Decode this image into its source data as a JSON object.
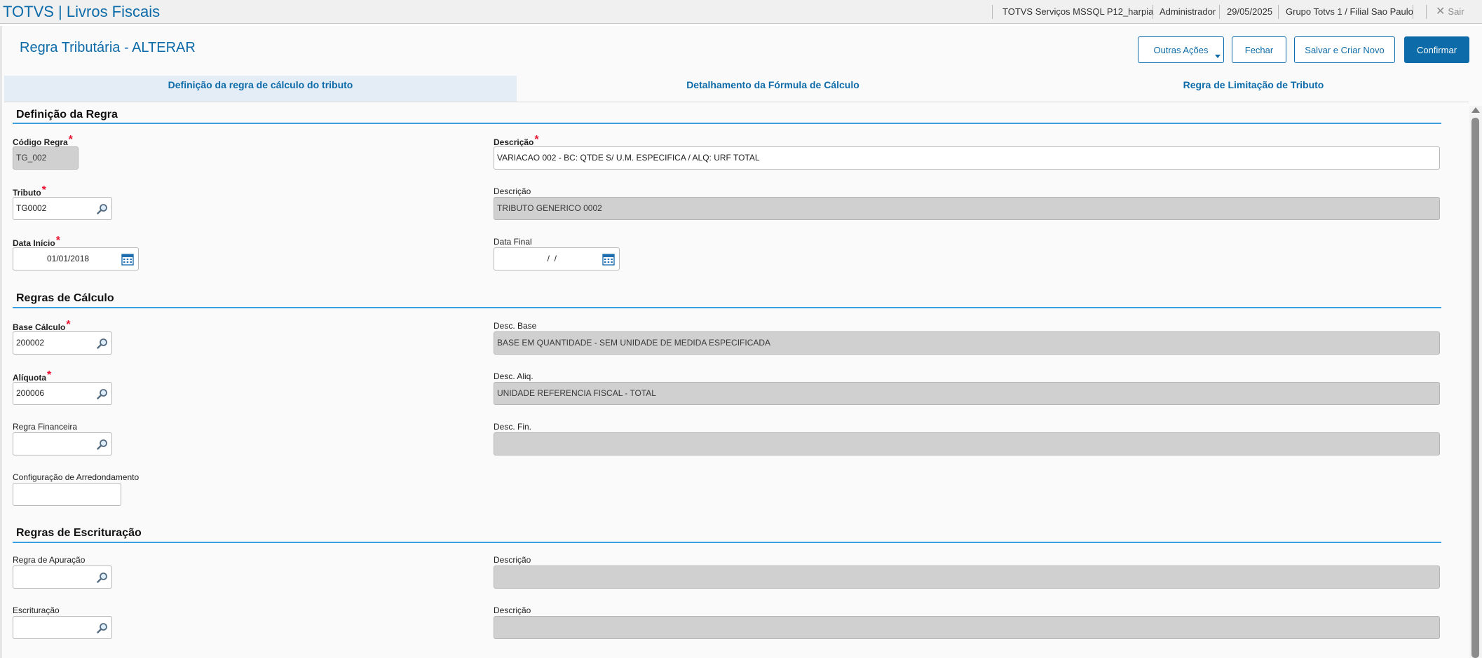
{
  "app": {
    "title": "TOTVS | Livros Fiscais",
    "environment": "TOTVS Serviços MSSQL P12_harpia",
    "user": "Administrador",
    "date": "29/05/2025",
    "branch": "Grupo Totvs 1 / Filial Sao Paulo",
    "logout_label": "Sair"
  },
  "page": {
    "title": "Regra Tributária - ALTERAR",
    "buttons": {
      "other_actions": "Outras Ações",
      "close": "Fechar",
      "save_new": "Salvar e Criar Novo",
      "confirm": "Confirmar"
    },
    "tabs": [
      {
        "label": "Definição da regra de cálculo do tributo",
        "active": true
      },
      {
        "label": "Detalhamento da Fórmula de Cálculo",
        "active": false
      },
      {
        "label": "Regra de Limitação de Tributo",
        "active": false
      }
    ]
  },
  "sections": {
    "definicao": {
      "title": "Definição da Regra",
      "codigo_regra": {
        "label": "Código Regra",
        "value": "TG_002"
      },
      "descricao": {
        "label": "Descrição",
        "value": "VARIACAO 002 - BC: QTDE S/ U.M. ESPECIFICA / ALQ: URF TOTAL"
      },
      "tributo": {
        "label": "Tributo",
        "value": "TG0002"
      },
      "tributo_desc": {
        "label": "Descrição",
        "value": "TRIBUTO GENERICO 0002"
      },
      "data_inicio": {
        "label": "Data Início",
        "value": "01/01/2018"
      },
      "data_final": {
        "label": "Data Final",
        "value": "  /  /"
      }
    },
    "calculo": {
      "title": "Regras de Cálculo",
      "base_calculo": {
        "label": "Base Cálculo",
        "value": "200002"
      },
      "desc_base": {
        "label": "Desc. Base",
        "value": "BASE EM QUANTIDADE - SEM UNIDADE DE MEDIDA ESPECIFICADA"
      },
      "aliquota": {
        "label": "Alíquota",
        "value": "200006"
      },
      "desc_aliq": {
        "label": "Desc. Aliq.",
        "value": "UNIDADE REFERENCIA FISCAL - TOTAL"
      },
      "regra_financeira": {
        "label": "Regra Financeira",
        "value": ""
      },
      "desc_fin": {
        "label": "Desc. Fin.",
        "value": ""
      },
      "arredondamento": {
        "label": "Configuração de Arredondamento",
        "value": ""
      }
    },
    "escrituracao": {
      "title": "Regras de Escrituração",
      "regra_apuracao": {
        "label": "Regra de Apuração",
        "value": ""
      },
      "apuracao_desc": {
        "label": "Descrição",
        "value": ""
      },
      "escrituracao": {
        "label": "Escrituração",
        "value": ""
      },
      "escrituracao_desc": {
        "label": "Descrição",
        "value": ""
      }
    }
  },
  "colors": {
    "accent": "#0c6ba8",
    "section_line": "#3a9fe0",
    "required": "#e8102f",
    "readonly_bg": "#d0d0d0"
  },
  "icons": [
    "search-icon",
    "calendar-icon",
    "close-icon",
    "chevron-down-icon"
  ]
}
